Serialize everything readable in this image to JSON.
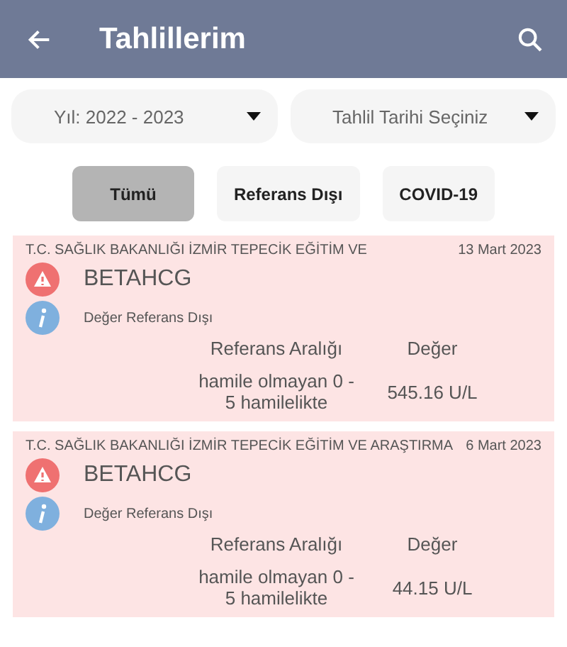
{
  "app_bar": {
    "title": "Tahlillerim"
  },
  "dropdowns": [
    {
      "value": "Yıl: 2022 - 2023"
    },
    {
      "value": "Tahlil Tarihi Seçiniz"
    }
  ],
  "filters": [
    {
      "label": "Tümü",
      "selected": true
    },
    {
      "label": "Referans Dışı",
      "selected": false
    },
    {
      "label": "COVID-19",
      "selected": false
    }
  ],
  "results": [
    {
      "institution": "T.C. SAĞLIK BAKANLIĞI İZMİR TEPECİK EĞİTİM VE",
      "date": "13 Mart 2023",
      "test": "BETAHCG",
      "status": "Değer Referans Dışı",
      "range_header": "Referans Aralığı",
      "value_header": "Değer",
      "range": "hamile olmayan 0 - 5 hamilelikte",
      "value": "545.16 U/L"
    },
    {
      "institution": "T.C. SAĞLIK BAKANLIĞI İZMİR TEPECİK EĞİTİM VE ARAŞTIRMA",
      "date": "6 Mart 2023",
      "test": "BETAHCG",
      "status": "Değer Referans Dışı",
      "range_header": "Referans Aralığı",
      "value_header": "Değer",
      "range": "hamile olmayan 0 - 5 hamilelikte",
      "value": "44.15 U/L"
    }
  ]
}
